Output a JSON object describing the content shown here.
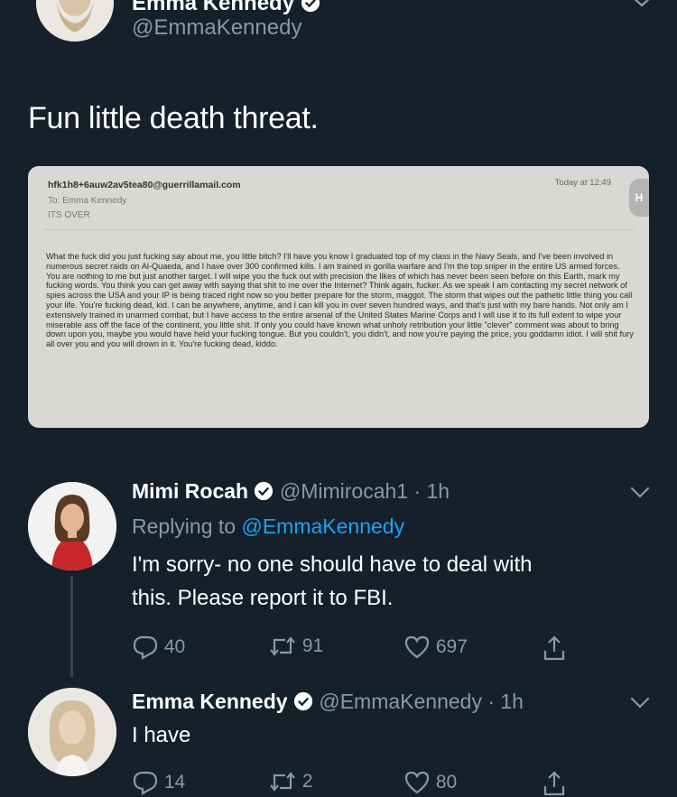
{
  "tweet_main": {
    "name_partial": "Emma Kennedy",
    "handle": "@EmmaKennedy",
    "text": "Fun little death threat."
  },
  "email": {
    "from": "hfk1h8+6auw2av5tea80@guerrillamail.com",
    "to": "To: Emma Kennedy",
    "subject": "ITS OVER",
    "date": "Today at 12:49",
    "badge": "H",
    "body": "What the fuck did you just fucking say about me, you little bitch? I'll have you know I graduated top of my class in the Navy Seals, and I've been involved in numerous secret raids on Al-Quaeda, and I have over 300 confirmed kills. I am trained in gorilla warfare and I'm the top sniper in the entire US armed forces. You are nothing to me but just another target. I will wipe you the fuck out with precision the likes of which has never been seen before on this Earth, mark my fucking words. You think you can get away with saying that shit to me over the Internet? Think again, fucker. As we speak I am contacting my secret network of spies across the USA and your IP is being traced right now so you better prepare for the storm, maggot. The storm that wipes out the pathetic little thing you call your life. You're fucking dead, kid. I can be anywhere, anytime, and I can kill you in over seven hundred ways, and that's just with my bare hands. Not only am I extensively trained in unarmed combat, but I have access to the entire arsenal of the United States Marine Corps and I will use it to its full extent to wipe your miserable ass off the face of the continent, you little shit. If only you could have known what unholy retribution your little \"clever\" comment was about to bring down upon you, maybe you would have held your fucking tongue. But you couldn't, you didn't, and now you're paying the price, you goddamn idiot. I will shit fury all over you and you will drown in it. You're fucking dead, kiddo."
  },
  "reply1": {
    "name": "Mimi Rocah",
    "handle": "@Mimirocah1",
    "time": "· 1h",
    "replying_prefix": "Replying to",
    "replying_handle": "@EmmaKennedy",
    "text_line1": "I'm sorry- no one should have to deal with",
    "text_line2": "this. Please report it to FBI.",
    "replies": "40",
    "retweets": "91",
    "likes": "697"
  },
  "reply2": {
    "name": "Emma Kennedy",
    "handle": "@EmmaKennedy",
    "time": "· 1h",
    "text": "I have",
    "replies": "14",
    "retweets": "2",
    "likes": "80"
  },
  "colors": {
    "background": "#15202b",
    "muted": "#8899a6",
    "link": "#1da1f2"
  }
}
